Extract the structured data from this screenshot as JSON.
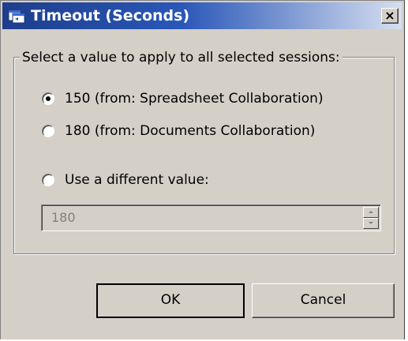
{
  "window": {
    "title": "Timeout (Seconds)",
    "close_label": "×",
    "title_color": "#ffffff",
    "titlebar_colors": [
      "#1e3e8c",
      "#d6dff0"
    ]
  },
  "group": {
    "legend": "Select a value to apply to all selected sessions:"
  },
  "options": [
    {
      "label": "150 (from: Spreadsheet Collaboration)",
      "checked": true
    },
    {
      "label": "180 (from: Documents Collaboration)",
      "checked": false
    },
    {
      "label": "Use a different value:",
      "checked": false
    }
  ],
  "custom_value": {
    "value": "180",
    "disabled": true
  },
  "buttons": {
    "ok": "OK",
    "cancel": "Cancel"
  },
  "icons": {
    "app": "app-window-icon",
    "close": "close-icon",
    "spin_up": "spin-up-icon",
    "spin_down": "spin-down-icon"
  }
}
